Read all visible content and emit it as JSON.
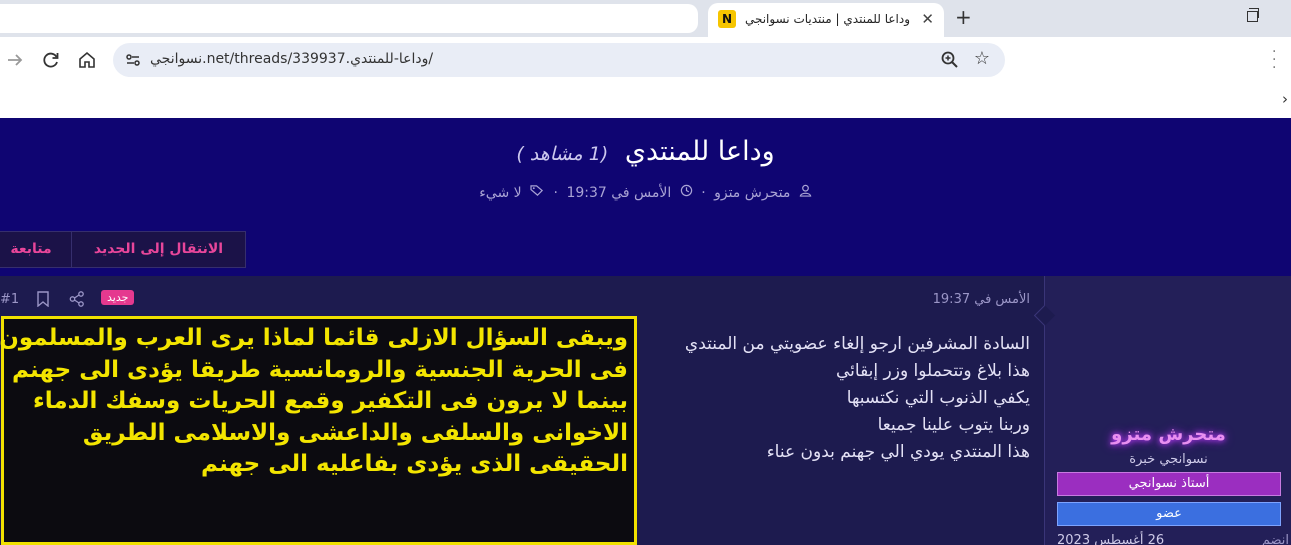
{
  "browser": {
    "tab_title": "وداعا للمنتدي | منتديات نسوانجي",
    "tab_favicon_letter": "N",
    "new_tab": "+",
    "tab_close": "✕",
    "url": "نسوانجي.net/threads/339937.وداعا-للمنتدي/"
  },
  "thread": {
    "title": "وداعا للمنتدي",
    "views": "(1 مشاهد )",
    "author": "متحرش متزو",
    "date": "الأمس في 19:37",
    "tags": "لا شيء",
    "btn_new": "الانتقال إلى الجديد",
    "btn_follow": "متابعة"
  },
  "post": {
    "date": "الأمس في 19:37",
    "number": "#1",
    "badge": "جديد",
    "lines": [
      "السادة المشرفين ارجو إلغاء عضويتي من المنتدي",
      "هذا بلاغ وتتحملوا وزر إبقائي",
      "يكفي الذنوب التي نكتسبها",
      "وربنا يتوب علينا جميعا",
      "هذا المنتدي يودي الي جهنم بدون عناء"
    ]
  },
  "overlay": {
    "lines": [
      "ويبقى السؤال الازلى قائما لماذا يرى العرب والمسلمون",
      "فى الحرية الجنسية والرومانسية طريقا يؤدى الى جهنم",
      "بينما لا يرون فى التكفير وقمع الحريات وسفك الدماء",
      "الاخوانى والسلفى والداعشى والاسلامى الطريق",
      "الحقيقى الذى يؤدى بفاعليه الى جهنم"
    ]
  },
  "author_card": {
    "name": "متحرش متزو",
    "title": "نسوانجي خبرة",
    "role_1": "أستاذ نسوانجي",
    "role_2": "عضو",
    "joined_label": "انضم",
    "joined_value": "26 أغسطس 2023"
  },
  "colors": {
    "hero_bg": "#0f0572",
    "accent_pink": "#e8469a",
    "overlay_yellow": "#f3e500"
  }
}
